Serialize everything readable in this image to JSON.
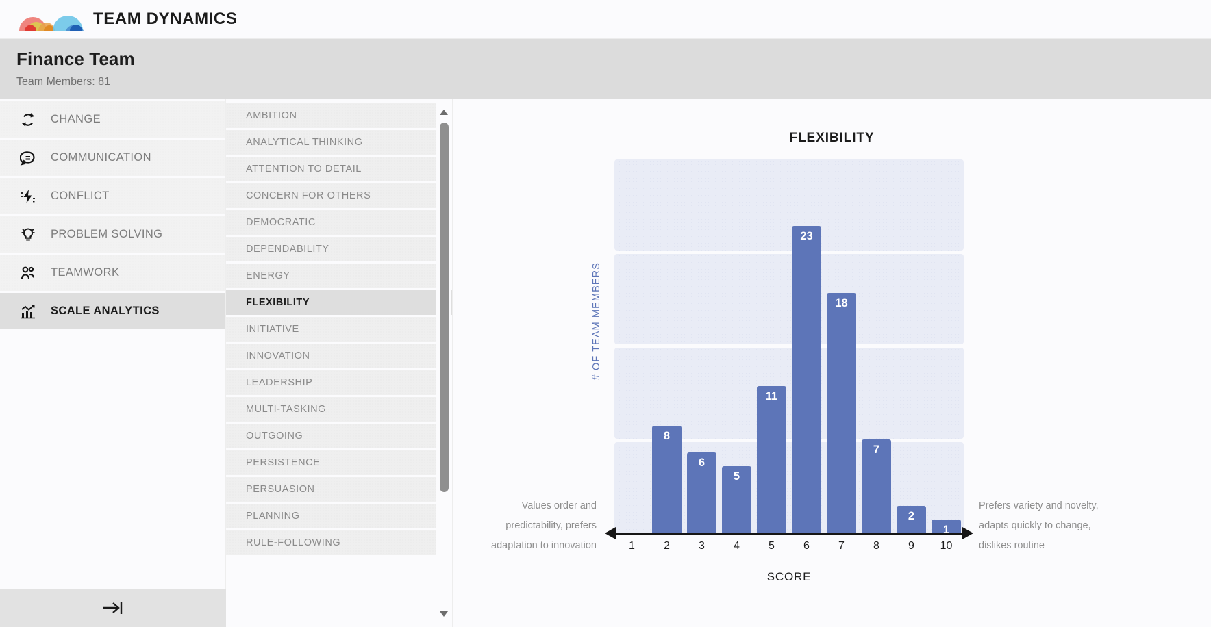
{
  "brand": {
    "name": "TEAM DYNAMICS",
    "logo_icon": "team-dynamics-arches-logo",
    "logo_colors": [
      "#ec6a63",
      "#d9d04a",
      "#e8a14a",
      "#6ec5e8",
      "#2f6fc4"
    ]
  },
  "header": {
    "team_name": "Finance Team",
    "members_label": "Team Members: 81"
  },
  "sidebar": {
    "items": [
      {
        "label": "CHANGE",
        "icon": "change-refresh-icon",
        "active": false
      },
      {
        "label": "COMMUNICATION",
        "icon": "speech-bubble-icon",
        "active": false
      },
      {
        "label": "CONFLICT",
        "icon": "lightning-bolt-icon",
        "active": false
      },
      {
        "label": "PROBLEM SOLVING",
        "icon": "lightbulb-icon",
        "active": false
      },
      {
        "label": "TEAMWORK",
        "icon": "people-group-icon",
        "active": false
      },
      {
        "label": "SCALE ANALYTICS",
        "icon": "bar-chart-trend-icon",
        "active": true
      }
    ],
    "collapse_icon": "collapse-sidebar-arrow-icon"
  },
  "scale_list": {
    "items": [
      {
        "label": "AMBITION",
        "selected": false
      },
      {
        "label": "ANALYTICAL THINKING",
        "selected": false
      },
      {
        "label": "ATTENTION TO DETAIL",
        "selected": false
      },
      {
        "label": "CONCERN FOR OTHERS",
        "selected": false
      },
      {
        "label": "DEMOCRATIC",
        "selected": false
      },
      {
        "label": "DEPENDABILITY",
        "selected": false
      },
      {
        "label": "ENERGY",
        "selected": false
      },
      {
        "label": "FLEXIBILITY",
        "selected": true
      },
      {
        "label": "INITIATIVE",
        "selected": false
      },
      {
        "label": "INNOVATION",
        "selected": false
      },
      {
        "label": "LEADERSHIP",
        "selected": false
      },
      {
        "label": "MULTI-TASKING",
        "selected": false
      },
      {
        "label": "OUTGOING",
        "selected": false
      },
      {
        "label": "PERSISTENCE",
        "selected": false
      },
      {
        "label": "PERSUASION",
        "selected": false
      },
      {
        "label": "PLANNING",
        "selected": false
      },
      {
        "label": "RULE-FOLLOWING",
        "selected": false
      }
    ],
    "scrollbar": {
      "up_arrow_icon": "scroll-up-arrow-icon",
      "down_arrow_icon": "scroll-down-arrow-icon",
      "thumb_icon": "scrollbar-thumb"
    }
  },
  "chart_data": {
    "type": "bar",
    "title": "FLEXIBILITY",
    "xlabel": "SCORE",
    "ylabel": "# OF TEAM MEMBERS",
    "categories": [
      "1",
      "2",
      "3",
      "4",
      "5",
      "6",
      "7",
      "8",
      "9",
      "10"
    ],
    "values": [
      0,
      8,
      6,
      5,
      11,
      23,
      18,
      7,
      2,
      1
    ],
    "ylim": [
      0,
      28
    ],
    "xlim_labels": [
      "1",
      "10"
    ],
    "grid": "horizontal-bands",
    "band_count": 4,
    "legend": "none",
    "bar_color": "#5d75b8",
    "band_color": "#e9ecf6",
    "label_color": "#ffffff",
    "annotations": {
      "left": "Values order and predictability, prefers adaptation to innovation",
      "right": "Prefers variety and novelty, adapts quickly to change, dislikes routine"
    }
  }
}
